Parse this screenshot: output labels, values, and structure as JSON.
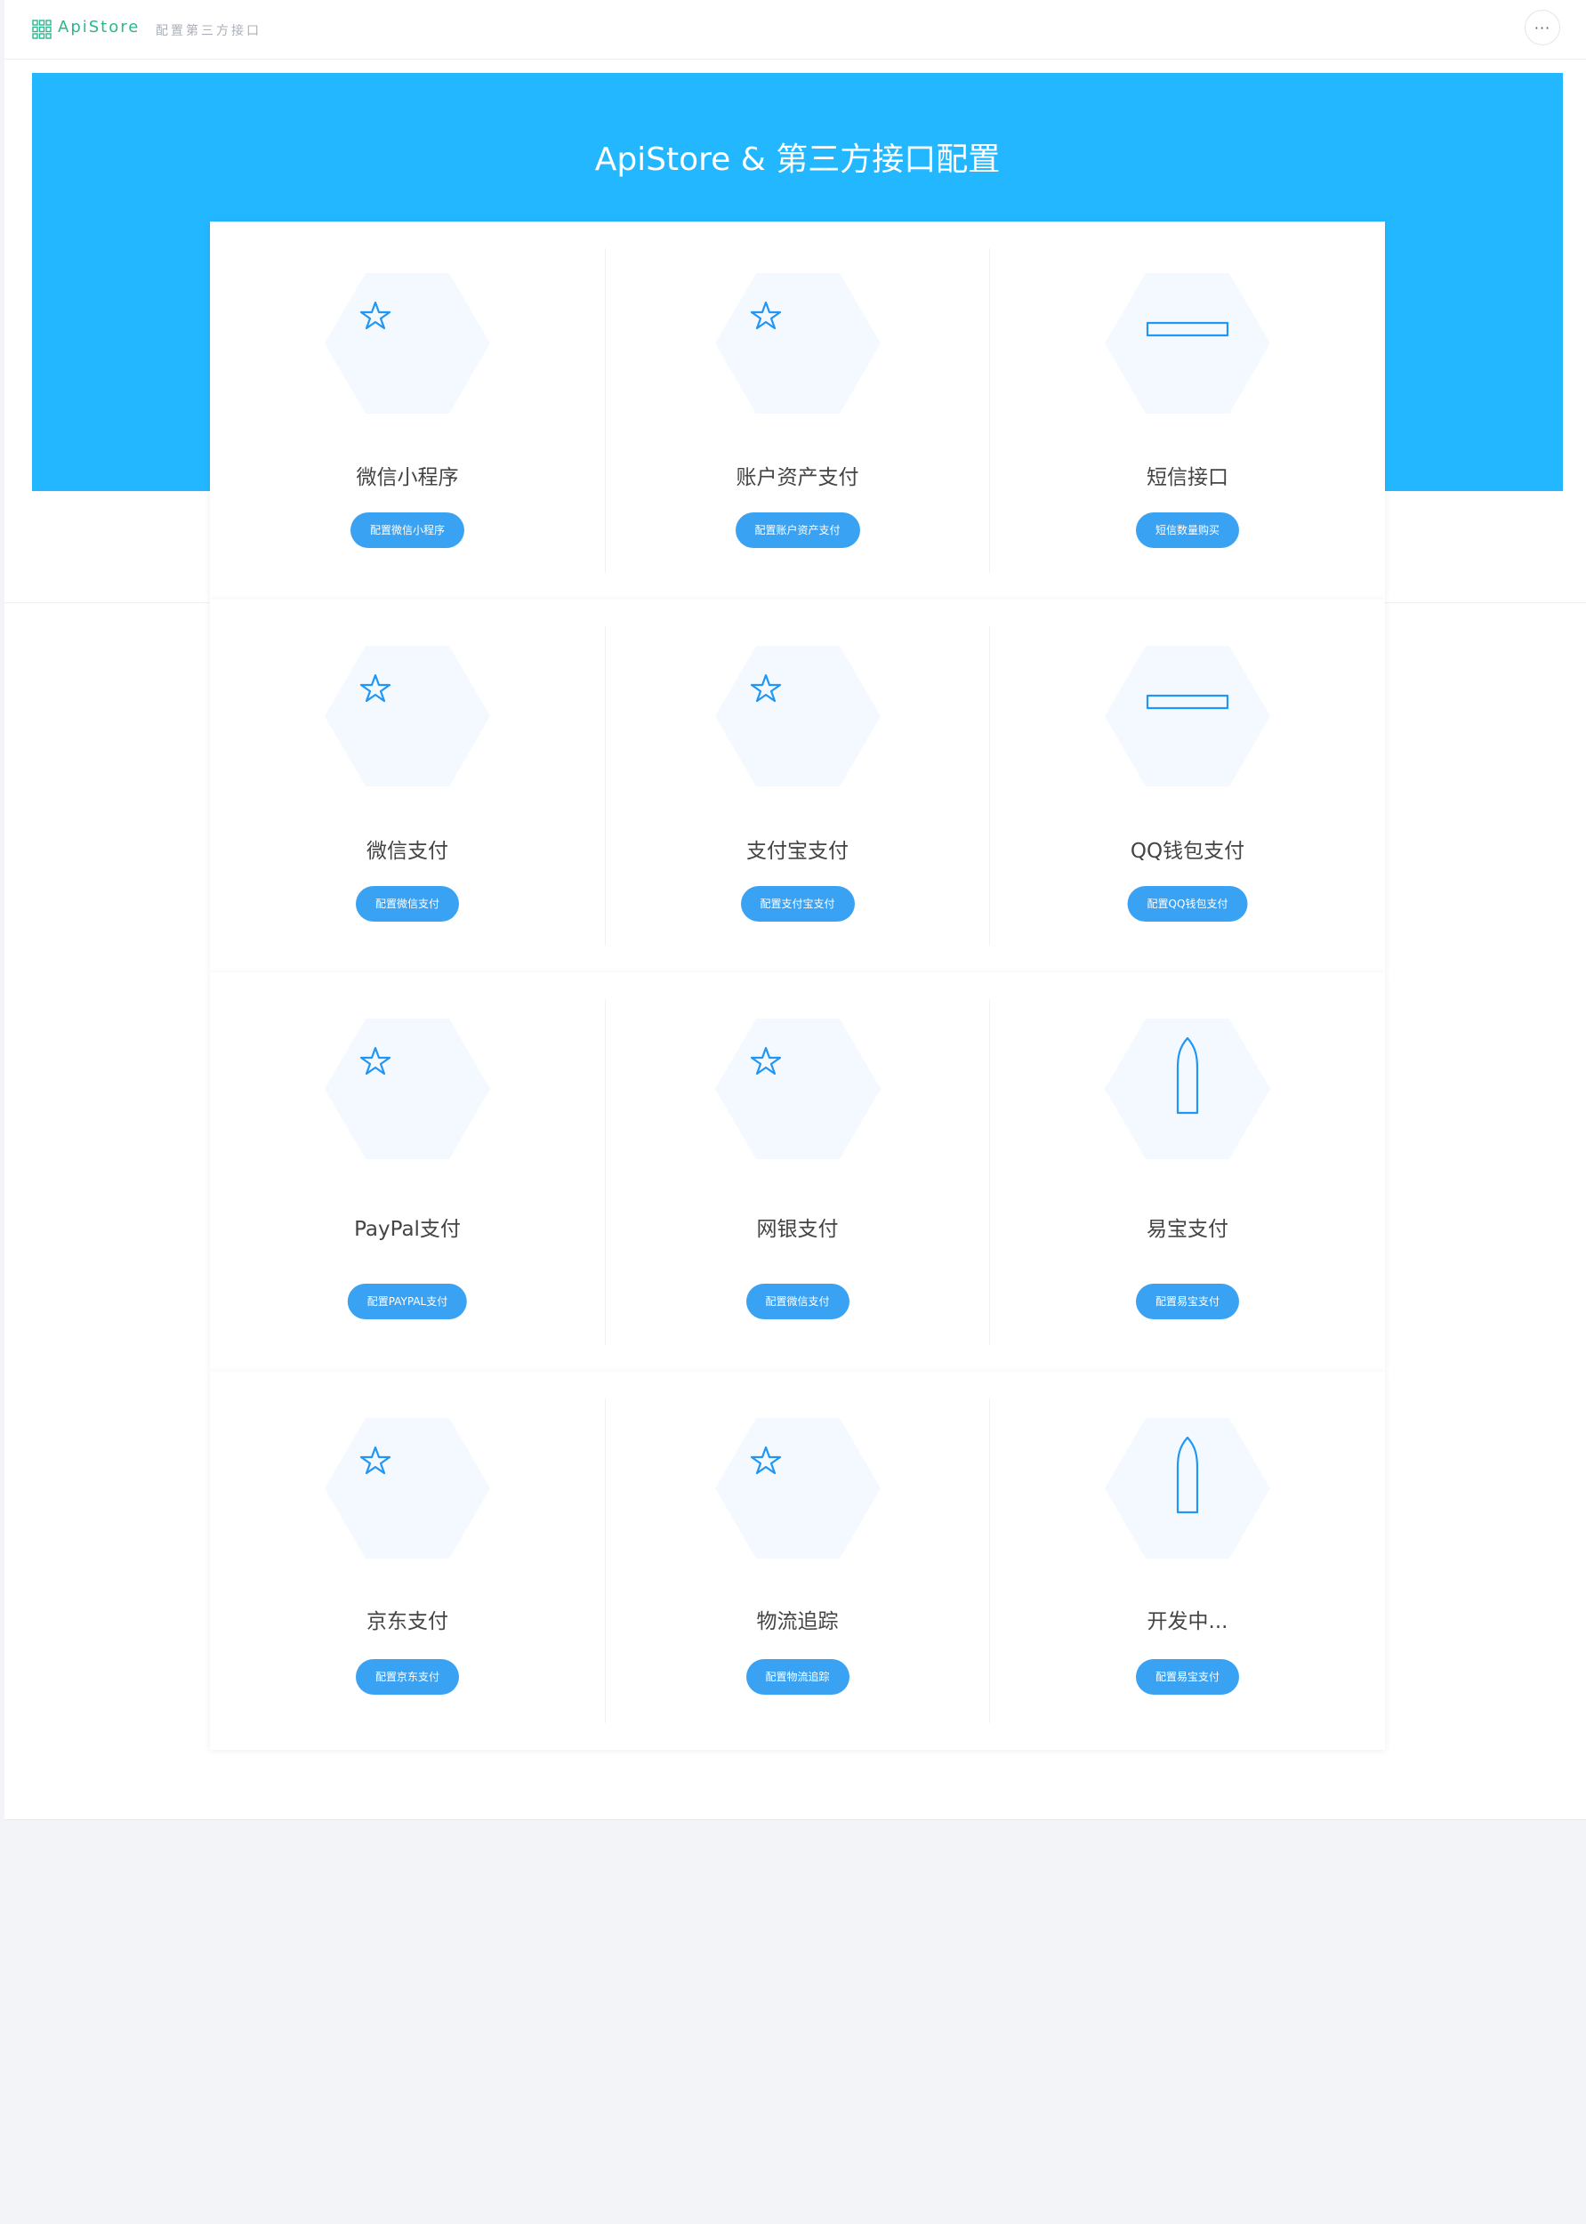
{
  "app": {
    "brand": "ApiStore",
    "subtitle": "配置第三方接口",
    "more": "···"
  },
  "hero": {
    "title": "ApiStore & 第三方接口配置"
  },
  "colors": {
    "hero": "#23b7ff",
    "button": "#3aa2f3",
    "brand": "#2ab68f",
    "icon": "#2196f3",
    "hex_bg": "#f3f9ff"
  },
  "rows": [
    [
      {
        "title": "微信小程序",
        "button": "配置微信小程序",
        "icon": "stars-icon"
      },
      {
        "title": "账户资产支付",
        "button": "配置账户资产支付",
        "icon": "stars-icon"
      },
      {
        "title": "短信接口",
        "button": "短信数量购买",
        "icon": "gift-icon"
      }
    ],
    [
      {
        "title": "微信支付",
        "button": "配置微信支付",
        "icon": "stars-icon"
      },
      {
        "title": "支付宝支付",
        "button": "配置支付宝支付",
        "icon": "stars-icon"
      },
      {
        "title": "QQ钱包支付",
        "button": "配置QQ钱包支付",
        "icon": "gift-icon"
      }
    ],
    [
      {
        "title": "PayPal支付",
        "button": "配置PAYPAL支付",
        "icon": "stars-icon"
      },
      {
        "title": "网银支付",
        "button": "配置微信支付",
        "icon": "stars-icon"
      },
      {
        "title": "易宝支付",
        "button": "配置易宝支付",
        "icon": "rocket-icon"
      }
    ],
    [
      {
        "title": "京东支付",
        "button": "配置京东支付",
        "icon": "stars-icon"
      },
      {
        "title": "物流追踪",
        "button": "配置物流追踪",
        "icon": "stars-icon"
      },
      {
        "title": "开发中...",
        "button": "配置易宝支付",
        "icon": "rocket-icon"
      }
    ]
  ]
}
